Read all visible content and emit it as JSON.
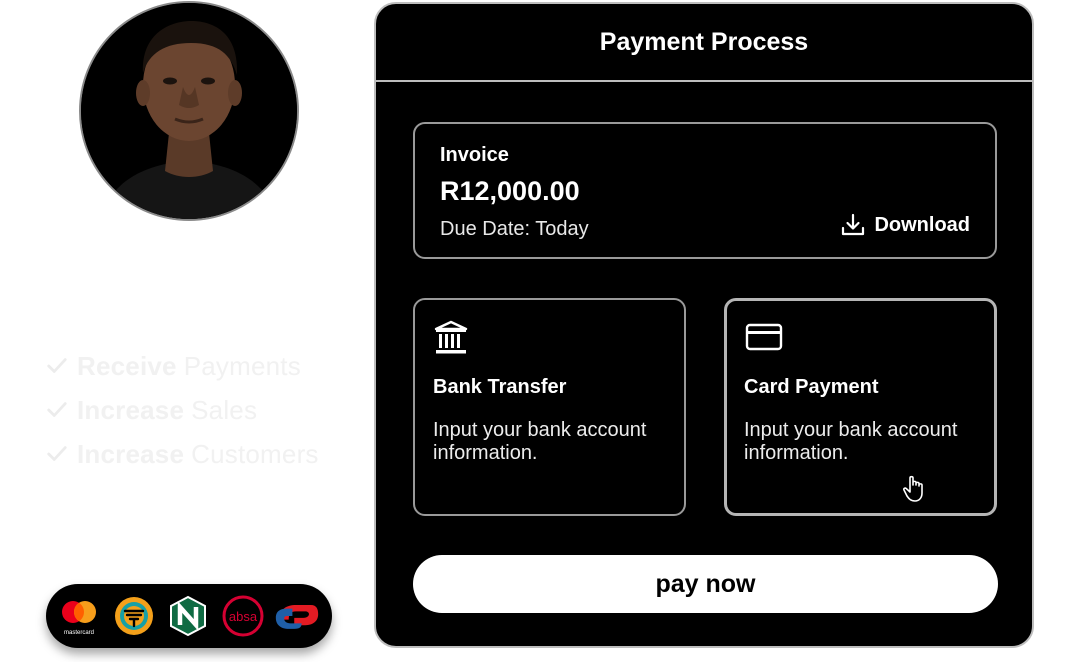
{
  "profile": {
    "avatar_icon": "person-portrait"
  },
  "features": [
    {
      "bold": "Receive",
      "rest": "Payments"
    },
    {
      "bold": "Increase",
      "rest": "Sales"
    },
    {
      "bold": "Increase",
      "rest": "Customers"
    }
  ],
  "banks": {
    "mastercard_text": "mastercard",
    "absa_text": "absa",
    "logos": [
      "mastercard-logo",
      "fnb-logo",
      "nedbank-logo",
      "absa-logo",
      "capitec-logo"
    ]
  },
  "panel": {
    "title": "Payment Process",
    "invoice": {
      "label": "Invoice",
      "amount": "R12,000.00",
      "due": "Due Date: Today",
      "download_label": "Download"
    },
    "options": [
      {
        "icon": "bank-icon",
        "title": "Bank Transfer",
        "desc": "Input your bank account information."
      },
      {
        "icon": "credit-card-icon",
        "title": "Card Payment",
        "desc": "Input your bank account information."
      }
    ],
    "pay_label": "pay now"
  },
  "colors": {
    "panel_bg": "#000000",
    "border": "#bdbdbd",
    "button_bg": "#ffffff",
    "feature_text": "#f1f1f1"
  }
}
